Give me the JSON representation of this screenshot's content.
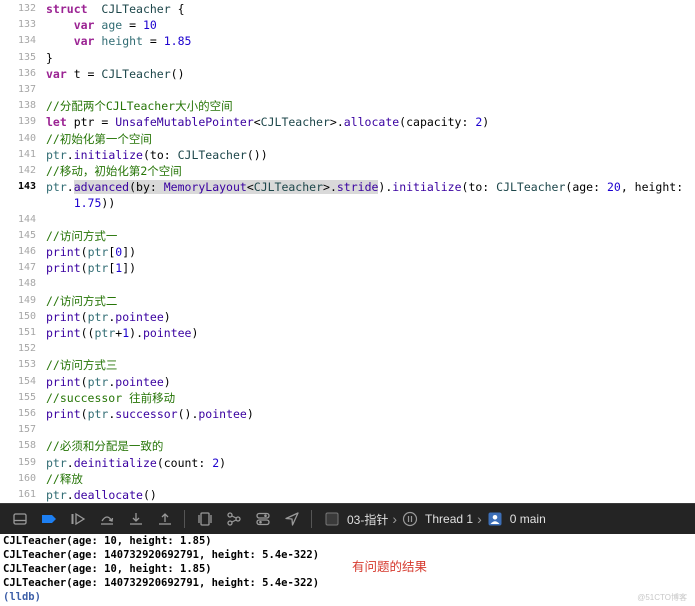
{
  "editor": {
    "current_line": "143",
    "lines": [
      {
        "n": "132",
        "segs": [
          [
            "kw",
            "struct"
          ],
          [
            "",
            "  "
          ],
          [
            "ty",
            "CJLTeacher"
          ],
          [
            "",
            " {"
          ]
        ]
      },
      {
        "n": "133",
        "segs": [
          [
            "",
            "    "
          ],
          [
            "kw",
            "var"
          ],
          [
            "",
            " "
          ],
          [
            "id",
            "age"
          ],
          [
            "",
            " = "
          ],
          [
            "num",
            "10"
          ]
        ]
      },
      {
        "n": "134",
        "segs": [
          [
            "",
            "    "
          ],
          [
            "kw",
            "var"
          ],
          [
            "",
            " "
          ],
          [
            "id",
            "height"
          ],
          [
            "",
            " = "
          ],
          [
            "num",
            "1.85"
          ]
        ]
      },
      {
        "n": "135",
        "segs": [
          [
            "",
            "}"
          ]
        ]
      },
      {
        "n": "136",
        "segs": [
          [
            "kw",
            "var"
          ],
          [
            "",
            " t = "
          ],
          [
            "ty",
            "CJLTeacher"
          ],
          [
            "",
            "()"
          ]
        ]
      },
      {
        "n": "137",
        "segs": []
      },
      {
        "n": "138",
        "segs": [
          [
            "cm",
            "//分配两个CJLTeacher大小的空间"
          ]
        ]
      },
      {
        "n": "139",
        "segs": [
          [
            "kw",
            "let"
          ],
          [
            "",
            " ptr = "
          ],
          [
            "tyk",
            "UnsafeMutablePointer"
          ],
          [
            "",
            "<"
          ],
          [
            "ty",
            "CJLTeacher"
          ],
          [
            "",
            ">."
          ],
          [
            "fn",
            "allocate"
          ],
          [
            "",
            "(capacity: "
          ],
          [
            "num",
            "2"
          ],
          [
            "",
            ")"
          ]
        ]
      },
      {
        "n": "140",
        "segs": [
          [
            "cm",
            "//初始化第一个空间"
          ]
        ]
      },
      {
        "n": "141",
        "segs": [
          [
            "id",
            "ptr"
          ],
          [
            "",
            "."
          ],
          [
            "fn",
            "initialize"
          ],
          [
            "",
            "(to: "
          ],
          [
            "ty",
            "CJLTeacher"
          ],
          [
            "",
            "())"
          ]
        ]
      },
      {
        "n": "142",
        "segs": [
          [
            "cm",
            "//移动，初始化第2个空间"
          ]
        ]
      },
      {
        "n": "143",
        "segs": [
          [
            "id",
            "ptr"
          ],
          [
            "",
            "."
          ],
          [
            "fn hl",
            "advanced"
          ],
          [
            "hl",
            "(by: "
          ],
          [
            "tyk hl",
            "MemoryLayout"
          ],
          [
            "hl",
            "<"
          ],
          [
            "ty hl",
            "CJLTeacher"
          ],
          [
            "hl",
            ">."
          ],
          [
            "fn hl",
            "stride"
          ],
          [
            "",
            ")."
          ],
          [
            "fn",
            "initialize"
          ],
          [
            "",
            "(to: "
          ],
          [
            "ty",
            "CJLTeacher"
          ],
          [
            "",
            "(age: "
          ],
          [
            "num",
            "20"
          ],
          [
            "",
            ", height:"
          ]
        ]
      },
      {
        "n": "",
        "segs": [
          [
            "",
            "    "
          ],
          [
            "num",
            "1.75"
          ],
          [
            "",
            "))"
          ]
        ]
      },
      {
        "n": "144",
        "segs": []
      },
      {
        "n": "145",
        "segs": [
          [
            "cm",
            "//访问方式一"
          ]
        ]
      },
      {
        "n": "146",
        "segs": [
          [
            "fn",
            "print"
          ],
          [
            "",
            "("
          ],
          [
            "id",
            "ptr"
          ],
          [
            "",
            "["
          ],
          [
            "num",
            "0"
          ],
          [
            "",
            "])"
          ]
        ]
      },
      {
        "n": "147",
        "segs": [
          [
            "fn",
            "print"
          ],
          [
            "",
            "("
          ],
          [
            "id",
            "ptr"
          ],
          [
            "",
            "["
          ],
          [
            "num",
            "1"
          ],
          [
            "",
            "])"
          ]
        ]
      },
      {
        "n": "148",
        "segs": []
      },
      {
        "n": "149",
        "segs": [
          [
            "cm",
            "//访问方式二"
          ]
        ]
      },
      {
        "n": "150",
        "segs": [
          [
            "fn",
            "print"
          ],
          [
            "",
            "("
          ],
          [
            "id",
            "ptr"
          ],
          [
            "",
            "."
          ],
          [
            "fn",
            "pointee"
          ],
          [
            "",
            ")"
          ]
        ]
      },
      {
        "n": "151",
        "segs": [
          [
            "fn",
            "print"
          ],
          [
            "",
            "(("
          ],
          [
            "id",
            "ptr"
          ],
          [
            "",
            "+"
          ],
          [
            "num",
            "1"
          ],
          [
            "",
            ")."
          ],
          [
            "fn",
            "pointee"
          ],
          [
            "",
            ")"
          ]
        ]
      },
      {
        "n": "152",
        "segs": []
      },
      {
        "n": "153",
        "segs": [
          [
            "cm",
            "//访问方式三"
          ]
        ]
      },
      {
        "n": "154",
        "segs": [
          [
            "fn",
            "print"
          ],
          [
            "",
            "("
          ],
          [
            "id",
            "ptr"
          ],
          [
            "",
            "."
          ],
          [
            "fn",
            "pointee"
          ],
          [
            "",
            ")"
          ]
        ]
      },
      {
        "n": "155",
        "segs": [
          [
            "cm",
            "//successor 往前移动"
          ]
        ]
      },
      {
        "n": "156",
        "segs": [
          [
            "fn",
            "print"
          ],
          [
            "",
            "("
          ],
          [
            "id",
            "ptr"
          ],
          [
            "",
            "."
          ],
          [
            "fn",
            "successor"
          ],
          [
            "",
            "()."
          ],
          [
            "fn",
            "pointee"
          ],
          [
            "",
            ")"
          ]
        ]
      },
      {
        "n": "157",
        "segs": []
      },
      {
        "n": "158",
        "segs": [
          [
            "cm",
            "//必须和分配是一致的"
          ]
        ]
      },
      {
        "n": "159",
        "segs": [
          [
            "id",
            "ptr"
          ],
          [
            "",
            "."
          ],
          [
            "fn",
            "deinitialize"
          ],
          [
            "",
            "(count: "
          ],
          [
            "num",
            "2"
          ],
          [
            "",
            ")"
          ]
        ]
      },
      {
        "n": "160",
        "segs": [
          [
            "cm",
            "//释放"
          ]
        ]
      },
      {
        "n": "161",
        "segs": [
          [
            "id",
            "ptr"
          ],
          [
            "",
            "."
          ],
          [
            "fn",
            "deallocate"
          ],
          [
            "",
            "()"
          ]
        ]
      }
    ]
  },
  "debug_bar": {
    "scheme": "03-指针",
    "thread": "Thread 1",
    "frame": "0 main",
    "icons": [
      "console-toggle-icon",
      "breakpoint-icon",
      "continue-icon",
      "step-over-icon",
      "step-into-icon",
      "step-out-icon",
      "view-debugger-icon",
      "memory-graph-icon",
      "environment-override-icon",
      "location-icon"
    ]
  },
  "console": {
    "lines": [
      "CJLTeacher(age: 10, height: 1.85)",
      "CJLTeacher(age: 140732920692791, height: 5.4e-322)",
      "CJLTeacher(age: 10, height: 1.85)",
      "CJLTeacher(age: 140732920692791, height: 5.4e-322)"
    ],
    "prompt": "(lldb)",
    "note": "有问题的结果",
    "watermark": "@51CTO博客"
  }
}
